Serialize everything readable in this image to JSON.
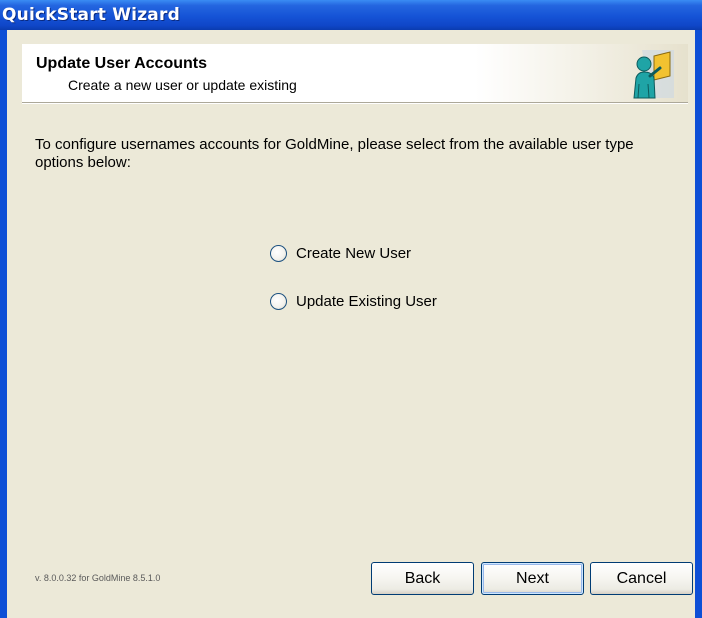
{
  "window": {
    "title": "QuickStart Wizard"
  },
  "header": {
    "title": "Update User Accounts",
    "subtitle": "Create a new user or update existing",
    "icon": "user-account-icon"
  },
  "main": {
    "instructions": "To configure usernames accounts for GoldMine, please select from the available user type options below:",
    "options": [
      {
        "label": "Create New User",
        "selected": false
      },
      {
        "label": "Update Existing User",
        "selected": false
      }
    ]
  },
  "footer": {
    "version": "v. 8.0.0.32 for GoldMine 8.5.1.0",
    "back_label": "Back",
    "next_label": "Next",
    "cancel_label": "Cancel"
  },
  "colors": {
    "titlebar": "#0f46c8",
    "window_bg": "#ece9d8",
    "button_border": "#003c74"
  }
}
